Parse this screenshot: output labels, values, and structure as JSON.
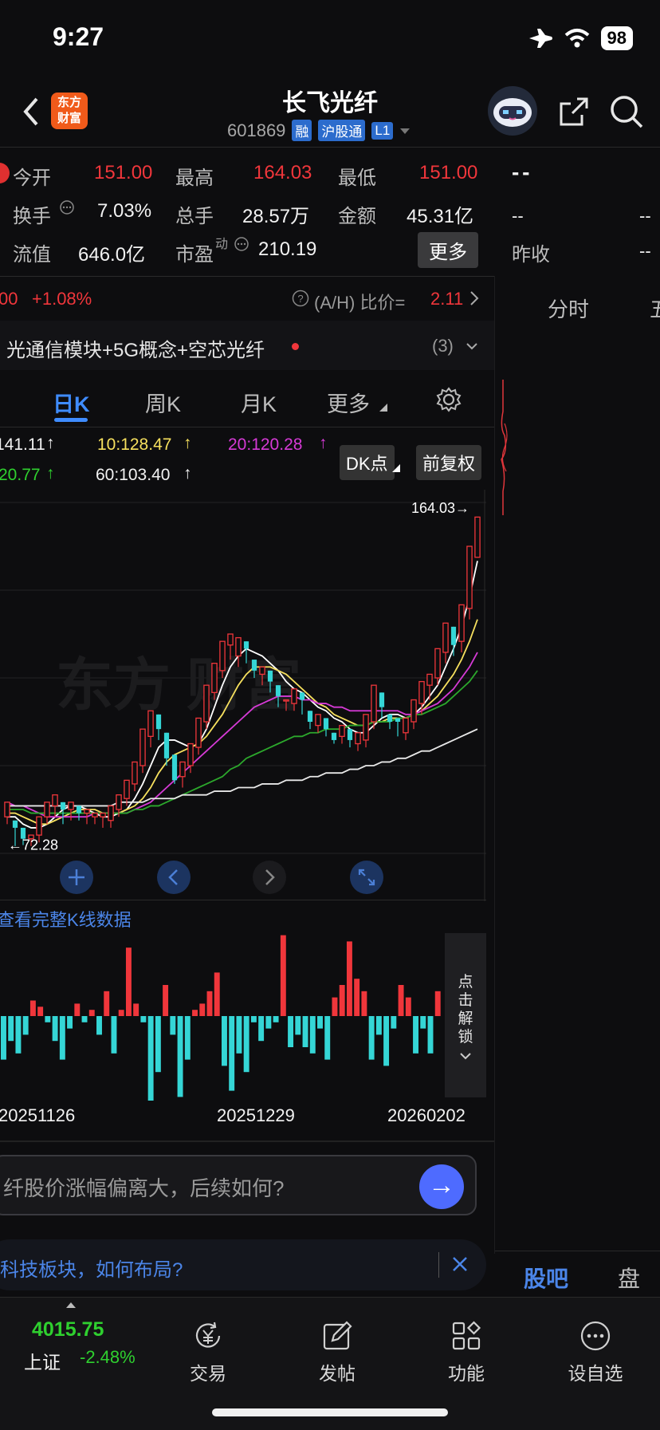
{
  "status": {
    "time": "9:27",
    "battery": "98"
  },
  "header": {
    "logo": "东方\n财富",
    "name": "长飞光纤",
    "code": "601869",
    "tags": [
      "融",
      "沪股通",
      "L1"
    ]
  },
  "quote": {
    "open_label": "今开",
    "open": "151.00",
    "high_label": "最高",
    "high": "164.03",
    "low_label": "最低",
    "low": "151.00",
    "turnover_label": "换手",
    "turnover": "7.03%",
    "volume_label": "总手",
    "volume": "28.57万",
    "amount_label": "金额",
    "amount": "45.31亿",
    "mktcap_label": "流值",
    "mktcap": "646.0亿",
    "pe_label": "市盈",
    "pe_sup": "动",
    "pe": "210.19",
    "more_button": "更多",
    "right_dash1": "- -",
    "right_dash2": "--",
    "right_dash3": "--",
    "prev_close_label": "昨收",
    "prev_close": "--"
  },
  "change": {
    "price_frag": "00",
    "pct": "+1.08%",
    "ah_label": "(A/H) 比价=",
    "ah_value": "2.11"
  },
  "concepts": {
    "text": "光通信模块+5G概念+空芯光纤",
    "count": "(3)"
  },
  "tabs": {
    "day": "日K",
    "week": "周K",
    "month": "月K",
    "more": "更多"
  },
  "ma": {
    "ma5": "141.11",
    "ma10": "10:128.47",
    "ma20": "20:120.28",
    "ma30": "20.77",
    "ma60": "60:103.40",
    "dk_button": "DK点",
    "adj_button": "前复权"
  },
  "chart_data": {
    "type": "candlestick",
    "title": "",
    "high_label": "164.03",
    "low_label": "72.28",
    "x_ticks": [
      "20251126",
      "20251229",
      "20260202"
    ],
    "price_range": [
      70,
      166
    ],
    "candles": [
      [
        80,
        84,
        78,
        79
      ],
      [
        79,
        77,
        72,
        78
      ],
      [
        77,
        74,
        72.28,
        76
      ],
      [
        74,
        75,
        72,
        74
      ],
      [
        75,
        80,
        73,
        80
      ],
      [
        80,
        84,
        78,
        83
      ],
      [
        83,
        86,
        80,
        84
      ],
      [
        84,
        82,
        78,
        80
      ],
      [
        82,
        84,
        79,
        83
      ],
      [
        83,
        81,
        79,
        80
      ],
      [
        81,
        82,
        78,
        79
      ],
      [
        80,
        81,
        78,
        80
      ],
      [
        80,
        81,
        77,
        78
      ],
      [
        79,
        83,
        77,
        82
      ],
      [
        82,
        86,
        80,
        85
      ],
      [
        85,
        90,
        83,
        89
      ],
      [
        89,
        95,
        87,
        94
      ],
      [
        94,
        104,
        92,
        102
      ],
      [
        102,
        109,
        99,
        108
      ],
      [
        108,
        104,
        101,
        103
      ],
      [
        103,
        96,
        94,
        97
      ],
      [
        97,
        90,
        89,
        91
      ],
      [
        91,
        95,
        88,
        94
      ],
      [
        94,
        100,
        92,
        99
      ],
      [
        99,
        107,
        97,
        106
      ],
      [
        106,
        116,
        104,
        114
      ],
      [
        114,
        122,
        112,
        120
      ],
      [
        120,
        128,
        118,
        127
      ],
      [
        127,
        130,
        123,
        124
      ],
      [
        124,
        129,
        121,
        128
      ],
      [
        128,
        126,
        122,
        123
      ],
      [
        123,
        120,
        118,
        119
      ],
      [
        119,
        121,
        116,
        120
      ],
      [
        120,
        117,
        114,
        116
      ],
      [
        116,
        113,
        110,
        112
      ],
      [
        112,
        112,
        109,
        111
      ],
      [
        111,
        115,
        109,
        114
      ],
      [
        114,
        112,
        108,
        109
      ],
      [
        109,
        106,
        104,
        105
      ],
      [
        105,
        108,
        103,
        107
      ],
      [
        107,
        104,
        102,
        103
      ],
      [
        103,
        101,
        100,
        102
      ],
      [
        102,
        105,
        100,
        104
      ],
      [
        104,
        101,
        99,
        100
      ],
      [
        100,
        103,
        98,
        101
      ],
      [
        101,
        108,
        99,
        106
      ],
      [
        106,
        116,
        104,
        114
      ],
      [
        114,
        110,
        107,
        108
      ],
      [
        108,
        106,
        104,
        107
      ],
      [
        107,
        106,
        102,
        103
      ],
      [
        103,
        107,
        101,
        106
      ],
      [
        106,
        112,
        104,
        111
      ],
      [
        111,
        117,
        108,
        116
      ],
      [
        116,
        119,
        112,
        118
      ],
      [
        118,
        126,
        116,
        125
      ],
      [
        125,
        133,
        122,
        132
      ],
      [
        132,
        127,
        124,
        128
      ],
      [
        128,
        138,
        125,
        137
      ],
      [
        137,
        154,
        134,
        152
      ],
      [
        151,
        162,
        151,
        160
      ]
    ],
    "ma_series": [
      {
        "name": "141.11",
        "color": "#ffffff",
        "values": [
          80,
          80,
          78,
          77,
          77,
          78,
          80,
          82,
          83,
          83,
          82,
          81,
          80,
          80,
          81,
          82,
          85,
          89,
          94,
          99,
          101,
          101,
          100,
          99,
          100,
          104,
          110,
          116,
          121,
          124,
          126,
          125,
          124,
          122,
          120,
          117,
          115,
          114,
          112,
          110,
          109,
          107,
          106,
          104,
          103,
          103,
          105,
          107,
          108,
          108,
          107,
          108,
          110,
          113,
          116,
          121,
          126,
          132,
          140,
          150
        ]
      },
      {
        "name": "10:128.47",
        "color": "#f6e05e",
        "values": [
          81,
          81,
          80,
          79,
          78,
          78,
          79,
          80,
          81,
          82,
          82,
          82,
          81,
          81,
          81,
          82,
          83,
          85,
          88,
          92,
          95,
          97,
          98,
          99,
          100,
          102,
          105,
          108,
          112,
          116,
          119,
          121,
          121,
          121,
          120,
          119,
          117,
          115,
          113,
          111,
          110,
          108,
          107,
          106,
          105,
          105,
          106,
          106,
          107,
          107,
          107,
          108,
          109,
          111,
          113,
          116,
          119,
          123,
          128,
          134
        ]
      },
      {
        "name": "20:120.28",
        "color": "#d63ad6",
        "values": [
          84,
          83,
          83,
          82,
          81,
          80,
          80,
          80,
          80,
          80,
          80,
          81,
          81,
          81,
          81,
          81,
          82,
          83,
          84,
          86,
          88,
          90,
          92,
          94,
          96,
          98,
          100,
          102,
          104,
          106,
          108,
          110,
          111,
          112,
          113,
          113,
          113,
          112,
          112,
          111,
          111,
          110,
          110,
          109,
          109,
          109,
          109,
          109,
          109,
          109,
          108,
          108,
          109,
          110,
          111,
          113,
          115,
          118,
          121,
          125
        ]
      },
      {
        "name": "20.77",
        "color": "#2ca82c",
        "values": [
          82,
          82,
          82,
          81,
          81,
          81,
          81,
          81,
          81,
          81,
          81,
          81,
          81,
          81,
          81,
          81,
          82,
          82,
          83,
          83,
          84,
          85,
          86,
          87,
          88,
          89,
          90,
          91,
          93,
          94,
          96,
          97,
          98,
          99,
          100,
          101,
          102,
          102,
          103,
          103,
          104,
          104,
          104,
          105,
          105,
          105,
          106,
          106,
          106,
          107,
          107,
          108,
          108,
          109,
          110,
          111,
          113,
          115,
          117,
          120
        ]
      },
      {
        "name": "60:103.40",
        "color": "#e8e8e8",
        "values": [
          83,
          83,
          83,
          83,
          83,
          83,
          83,
          83,
          83,
          83,
          83,
          83,
          83,
          83,
          84,
          84,
          84,
          84,
          85,
          85,
          85,
          85,
          86,
          86,
          86,
          86,
          87,
          87,
          87,
          88,
          88,
          88,
          89,
          89,
          89,
          90,
          90,
          90,
          91,
          91,
          92,
          92,
          92,
          93,
          93,
          94,
          94,
          95,
          95,
          96,
          96,
          97,
          98,
          98,
          99,
          100,
          101,
          102,
          103,
          104
        ]
      }
    ],
    "volume": [
      -14,
      -8,
      -12,
      -6,
      5,
      3,
      -2,
      -8,
      -14,
      -4,
      4,
      -2,
      2,
      -6,
      8,
      -12,
      2,
      22,
      4,
      -2,
      -28,
      -18,
      10,
      -6,
      -26,
      -14,
      2,
      4,
      8,
      14,
      -16,
      -24,
      -12,
      -18,
      -2,
      -8,
      -4,
      -2,
      26,
      -10,
      -6,
      -10,
      -12,
      -4,
      -14,
      6,
      10,
      24,
      12,
      8,
      -14,
      -6,
      -16,
      -4,
      10,
      6,
      -12,
      -4,
      -12,
      8
    ]
  },
  "kline_controls": {
    "full_data_link": "查看完整K线数据",
    "unlock": "点击解锁"
  },
  "ai": {
    "placeholder": "纤股价涨幅偏离大，后续如何?"
  },
  "banner": {
    "text": "科技板块，如何布局?"
  },
  "right_panel": {
    "tab_fenshi": "分时",
    "tab_five": "五",
    "tab_guba": "股吧",
    "tab_pankou": "盘口"
  },
  "bottom_nav": {
    "index_value": "4015.75",
    "index_name": "上证",
    "index_pct": "-2.48%",
    "trade": "交易",
    "post": "发帖",
    "features": "功能",
    "watchlist": "设自选"
  }
}
